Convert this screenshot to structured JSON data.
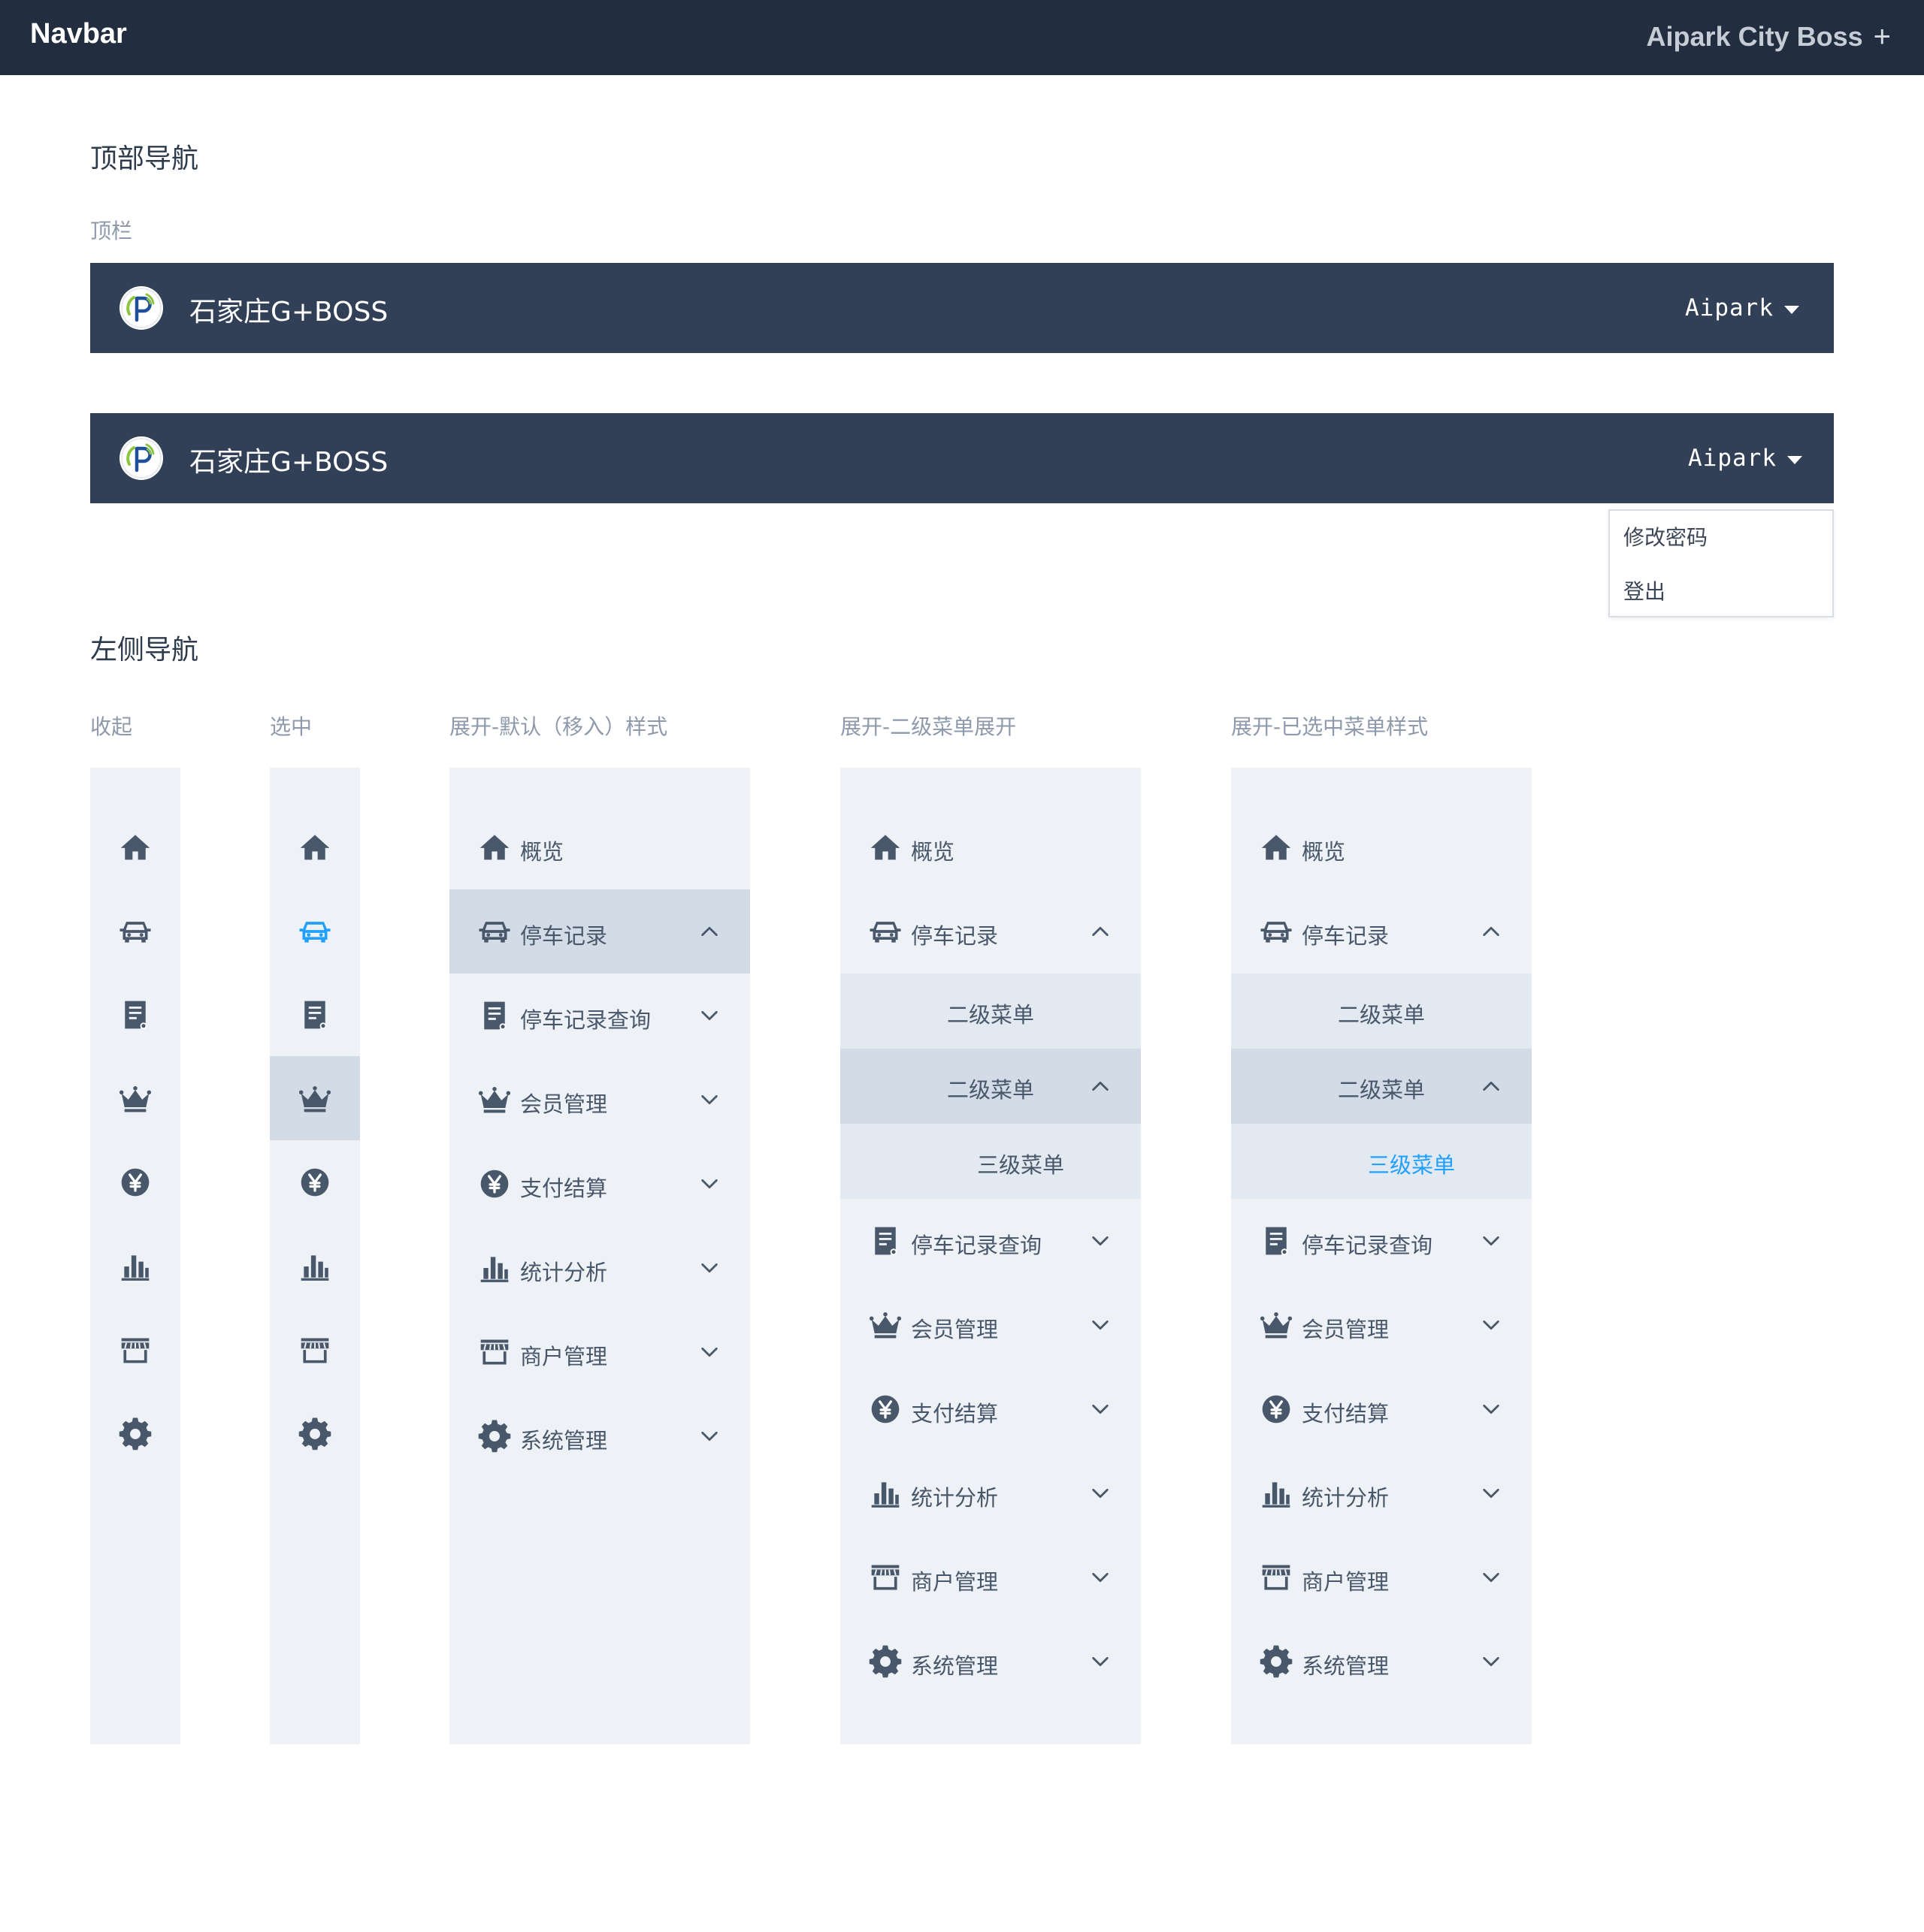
{
  "appbar": {
    "brand": "Navbar",
    "project": "Aipark City Boss",
    "plus": "+"
  },
  "sections": {
    "top_nav_title": "顶部导航",
    "top_bar_label": "顶栏",
    "left_nav_title": "左侧导航"
  },
  "header": {
    "system_name": "石家庄G+BOSS",
    "user": "Aipark"
  },
  "user_menu": {
    "items": [
      "修改密码",
      "登出"
    ]
  },
  "left_nav_states": [
    "收起",
    "选中",
    "展开-默认（移入）样式",
    "展开-二级菜单展开",
    "展开-已选中菜单样式"
  ],
  "menu": {
    "overview": "概览",
    "parking_records": "停车记录",
    "parking_query": "停车记录查询",
    "members": "会员管理",
    "payment": "支付结算",
    "stats": "统计分析",
    "merchants": "商户管理",
    "system": "系统管理",
    "level2": "二级菜单",
    "level3": "三级菜单"
  },
  "colors": {
    "appbar_bg": "#222e3f",
    "header_bg": "#324057",
    "sidebar_bg": "#eef1f6",
    "hover_bg": "#d3dbe6",
    "submenu_bg": "#e3e9f1",
    "icon": "#48576a",
    "active_accent": "#20a0ff"
  },
  "icons": [
    "home-icon",
    "car-icon",
    "document-icon",
    "crown-icon",
    "yen-icon",
    "bar-chart-icon",
    "store-icon",
    "gear-icon",
    "chevron-up-icon",
    "chevron-down-icon",
    "caret-down-icon",
    "logo-icon"
  ]
}
